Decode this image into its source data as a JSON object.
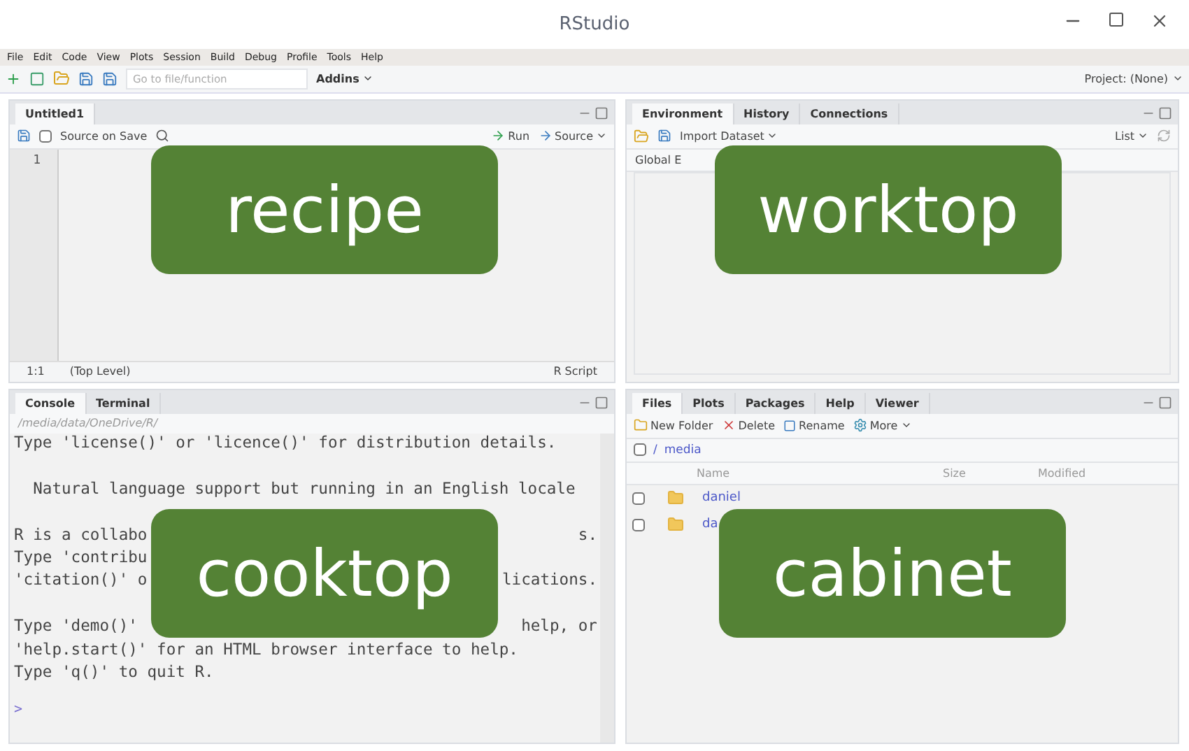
{
  "window": {
    "title": "RStudio"
  },
  "menu": [
    "File",
    "Edit",
    "Code",
    "View",
    "Plots",
    "Session",
    "Build",
    "Debug",
    "Profile",
    "Tools",
    "Help"
  ],
  "toolbar": {
    "search": {
      "placeholder": "Go to file/function"
    },
    "addins": "Addins",
    "project": "Project: (None)"
  },
  "editor": {
    "overlay_label": "recipe",
    "tabs": [
      {
        "label": "Untitled1",
        "selected": true
      }
    ],
    "source_on_save": {
      "label": "Source on Save",
      "checked": false
    },
    "run": "Run",
    "source": "Source",
    "line_numbers": [
      "1"
    ],
    "status": {
      "position": "1:1",
      "scope": "(Top Level)",
      "file_type": "R Script"
    }
  },
  "environment": {
    "overlay_label": "worktop",
    "tabs": [
      {
        "label": "Environment",
        "selected": true
      },
      {
        "label": "History",
        "selected": false
      },
      {
        "label": "Connections",
        "selected": false
      }
    ],
    "import": "Import Dataset",
    "view": "List",
    "scope": "Global E"
  },
  "console": {
    "overlay_label": "cooktop",
    "tabs": [
      {
        "label": "Console",
        "selected": true
      },
      {
        "label": "Terminal",
        "selected": false
      }
    ],
    "path": "/media/data/OneDrive/R/",
    "lines": [
      {
        "left": "Type 'license()' or 'licence()' for distribution details."
      },
      {
        "blank_before": true,
        "left": "  Natural language support but running in an English locale"
      },
      {
        "blank_before": true,
        "left": "R is a collabo",
        "right": "s."
      },
      {
        "left": "Type 'contribu"
      },
      {
        "left": "'citation()' o",
        "right": "lications."
      },
      {
        "blank_before": true,
        "left": "Type 'demo()'",
        "right": "help, or"
      },
      {
        "left": "'help.start()' for an HTML browser interface to help."
      },
      {
        "left": "Type 'q()' to quit R."
      }
    ],
    "prompt": ">"
  },
  "files": {
    "overlay_label": "cabinet",
    "tabs": [
      {
        "label": "Files",
        "selected": true
      },
      {
        "label": "Plots",
        "selected": false
      },
      {
        "label": "Packages",
        "selected": false
      },
      {
        "label": "Help",
        "selected": false
      },
      {
        "label": "Viewer",
        "selected": false
      }
    ],
    "actions": [
      {
        "kind": "folder",
        "label": "New Folder"
      },
      {
        "kind": "delete",
        "label": "Delete"
      },
      {
        "kind": "rename",
        "label": "Rename"
      },
      {
        "kind": "more",
        "label": "More"
      }
    ],
    "select_all": {
      "checked": false
    },
    "breadcrumb": [
      "/",
      "media"
    ],
    "columns": [
      "Name",
      "Size",
      "Modified"
    ],
    "rows": [
      {
        "name": "daniel",
        "checked": false
      },
      {
        "name": "da",
        "checked": false
      }
    ]
  }
}
